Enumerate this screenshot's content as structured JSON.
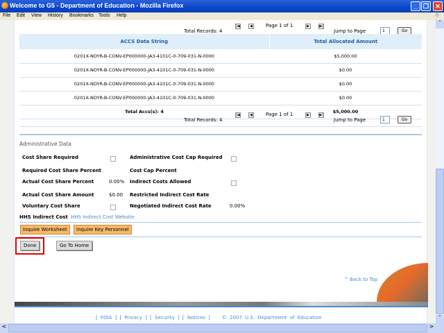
{
  "window": {
    "title": "Welcome to G5 - Department of Education - Mozilla Firefox"
  },
  "menu": [
    "File",
    "Edit",
    "View",
    "History",
    "Bookmarks",
    "Tools",
    "Help"
  ],
  "pager": {
    "total_records": "Total Records: 4",
    "page_info": "Page 1 of 1",
    "jump_label": "Jump to Page",
    "jump_value": "1",
    "go_label": "Go"
  },
  "table": {
    "headers": [
      "ACCS Data String",
      "Total Allocated Amount"
    ],
    "rows": [
      [
        "0201X-NOYR-B-CONV-EP000000-JA3-4101C-0-709-031-N-0000",
        "$5,000.00"
      ],
      [
        "0201X-NOYR-B-CONV-EP000000-JA3-4101C-0-709-031-N-0000",
        "$0.00"
      ],
      [
        "0201X-NOYR-B-CONV-EP000000-JA3-4101C-0-709-031-N-0000",
        "$0.00"
      ],
      [
        "0201X-NOYR-B-CONV-EP000000-JA3-4101C-0-709-031-N-0000",
        "$0.00"
      ]
    ],
    "total_label": "Total Accs(s): 4",
    "total_value": "$5,000.00"
  },
  "admin": {
    "title": "Administrative Data",
    "cost_share_required": "Cost Share Required",
    "admin_cost_cap_required": "Administrative Cost Cap Required",
    "required_cost_share_percent": "Required Cost Share Percent",
    "cost_cap_percent": "Cost Cap Percent",
    "actual_cost_share_percent": "Actual Cost Share Percent",
    "actual_cost_share_percent_value": "0.00%",
    "indirect_costs_allowed": "Indirect Costs Allowed",
    "actual_cost_share_amount": "Actual Cost Share Amount",
    "actual_cost_share_amount_value": "$0.00",
    "restricted_indirect_cost_rate": "Restricted Indirect Cost Rate",
    "voluntary_cost_share": "Voluntary Cost Share",
    "negotiated_indirect_cost_rate": "Negotiated Indirect Cost Rate",
    "negotiated_value": "0.00%",
    "hhs_label": "HHS Indirect Cost",
    "hhs_link": "HHS Indirect Cost Website"
  },
  "buttons": {
    "inquire_worksheet": "Inquire Worksheet",
    "inquire_key_personnel": "Inquire Key Personnel",
    "done": "Done",
    "go_home": "Go To Home"
  },
  "back_to_top": "^ Back to Top",
  "footer": {
    "links": [
      "FOIA",
      "Privacy",
      "Security",
      "Notices"
    ],
    "copyright": "© 2007 U.S. Department of Education"
  },
  "colors": {
    "highlight": "#e00000",
    "header_bg": "#dfeef8",
    "orange_button": "#f7b96a"
  }
}
